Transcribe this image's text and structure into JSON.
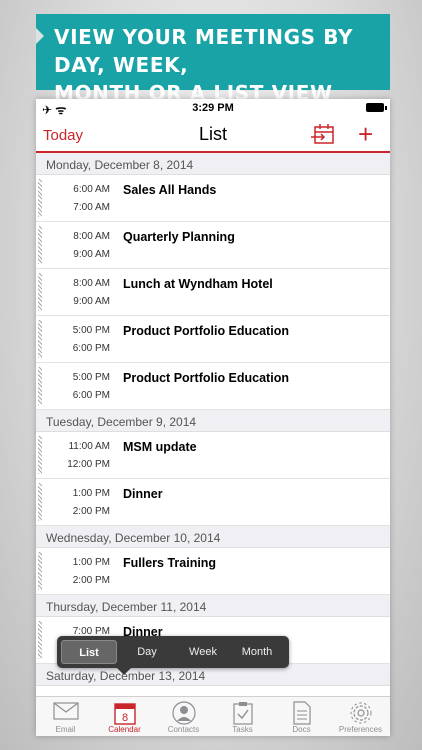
{
  "banner": {
    "line1": "VIEW YOUR MEETINGS BY DAY, WEEK,",
    "line2": "MONTH OR A LIST VIEW"
  },
  "status_bar": {
    "time": "3:29 PM"
  },
  "nav": {
    "today_label": "Today",
    "title": "List",
    "add_label": "+"
  },
  "days": [
    {
      "header": "Monday, December 8, 2014",
      "events": [
        {
          "start": "6:00 AM",
          "end": "7:00 AM",
          "title": "Sales All Hands"
        },
        {
          "start": "8:00 AM",
          "end": "9:00 AM",
          "title": "Quarterly Planning"
        },
        {
          "start": "8:00 AM",
          "end": "9:00 AM",
          "title": "Lunch at Wyndham Hotel"
        },
        {
          "start": "5:00 PM",
          "end": "6:00 PM",
          "title": "Product Portfolio Education"
        },
        {
          "start": "5:00 PM",
          "end": "6:00 PM",
          "title": "Product Portfolio Education"
        }
      ]
    },
    {
      "header": "Tuesday, December 9, 2014",
      "events": [
        {
          "start": "11:00 AM",
          "end": "12:00 PM",
          "title": "MSM update"
        },
        {
          "start": "1:00 PM",
          "end": "2:00 PM",
          "title": "Dinner"
        }
      ]
    },
    {
      "header": "Wednesday, December 10, 2014",
      "events": [
        {
          "start": "1:00 PM",
          "end": "2:00 PM",
          "title": "Fullers Training"
        }
      ]
    },
    {
      "header": "Thursday, December 11, 2014",
      "events": [
        {
          "start": "7:00 PM",
          "end": "",
          "title": "Dinner"
        }
      ]
    },
    {
      "header": "Saturday, December 13, 2014",
      "events": []
    }
  ],
  "view_switcher": {
    "options": [
      "List",
      "Day",
      "Week",
      "Month"
    ],
    "selected": "List"
  },
  "tab_bar": {
    "tabs": [
      {
        "label": "Email",
        "icon": "envelope-icon"
      },
      {
        "label": "Calendar",
        "icon": "calendar-icon",
        "badge": "8"
      },
      {
        "label": "Contacts",
        "icon": "person-icon"
      },
      {
        "label": "Tasks",
        "icon": "checklist-icon"
      },
      {
        "label": "Docs",
        "icon": "document-icon"
      },
      {
        "label": "Preferences",
        "icon": "gear-icon"
      }
    ],
    "active": "Calendar"
  },
  "colors": {
    "accent": "#c9262b",
    "banner": "#1aa3a6"
  }
}
